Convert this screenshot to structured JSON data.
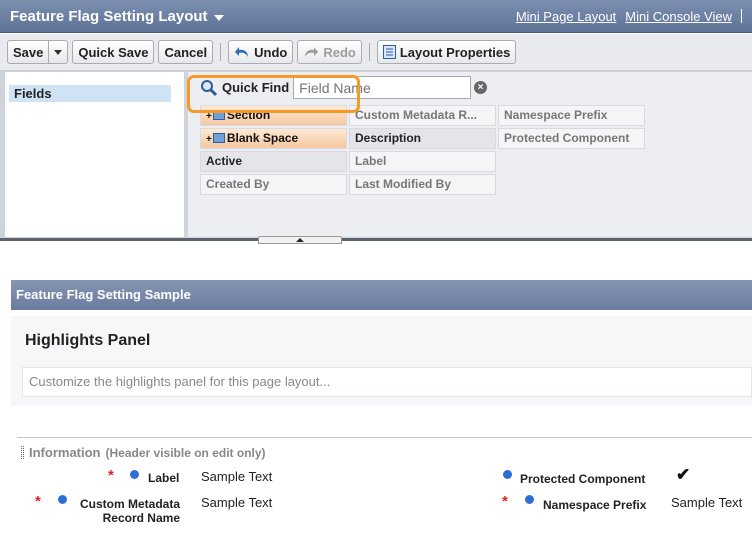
{
  "header": {
    "title": "Feature Flag Setting Layout",
    "links": [
      "Mini Page Layout",
      "Mini Console View"
    ]
  },
  "toolbar": {
    "save": "Save",
    "quick_save": "Quick Save",
    "cancel": "Cancel",
    "undo": "Undo",
    "redo": "Redo",
    "layout_properties": "Layout Properties"
  },
  "palette": {
    "categories": [
      "Fields"
    ],
    "quick_find_label": "Quick Find",
    "quick_find_placeholder": "Field Name",
    "items": [
      "Section",
      "Custom Metadata R...",
      "Namespace Prefix",
      "Blank Space",
      "Description",
      "Protected Component",
      "Active",
      "Label",
      "Created By",
      "Last Modified By"
    ]
  },
  "layout": {
    "section_title": "Feature Flag Setting Sample",
    "highlights_title": "Highlights Panel",
    "highlights_hint": "Customize the highlights panel for this page layout...",
    "info_title": "Information",
    "info_subtitle": "(Header visible on edit only)",
    "fields": {
      "label": "Label",
      "label_value": "Sample Text",
      "record_name_line1": "Custom Metadata",
      "record_name_line2": "Record Name",
      "record_name_value": "Sample Text",
      "protected": "Protected Component",
      "protected_value": "✔",
      "namespace": "Namespace Prefix",
      "namespace_value": "Sample Text"
    },
    "required_mark": "*"
  }
}
